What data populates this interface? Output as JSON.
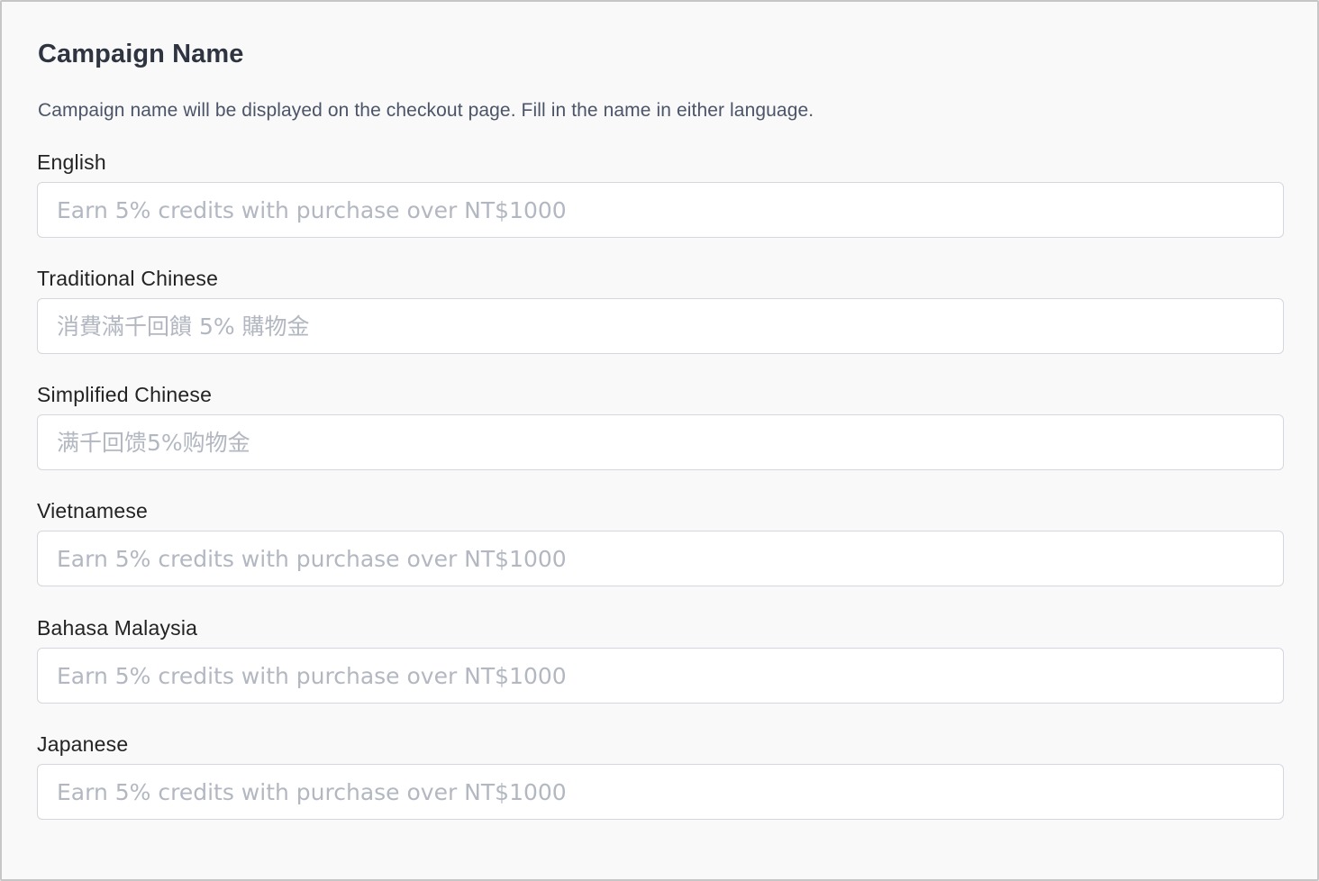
{
  "section": {
    "title": "Campaign Name",
    "description": "Campaign name will be displayed on the checkout page. Fill in the name in either language."
  },
  "fields": [
    {
      "label": "English",
      "value": "",
      "placeholder": "Earn 5% credits with purchase over NT$1000"
    },
    {
      "label": "Traditional Chinese",
      "value": "",
      "placeholder": "消費滿千回饋 5% 購物金"
    },
    {
      "label": "Simplified Chinese",
      "value": "",
      "placeholder": "满千回馈5%购物金"
    },
    {
      "label": "Vietnamese",
      "value": "",
      "placeholder": "Earn 5% credits with purchase over NT$1000"
    },
    {
      "label": "Bahasa Malaysia",
      "value": "",
      "placeholder": "Earn 5% credits with purchase over NT$1000"
    },
    {
      "label": "Japanese",
      "value": "",
      "placeholder": "Earn 5% credits with purchase over NT$1000"
    }
  ]
}
